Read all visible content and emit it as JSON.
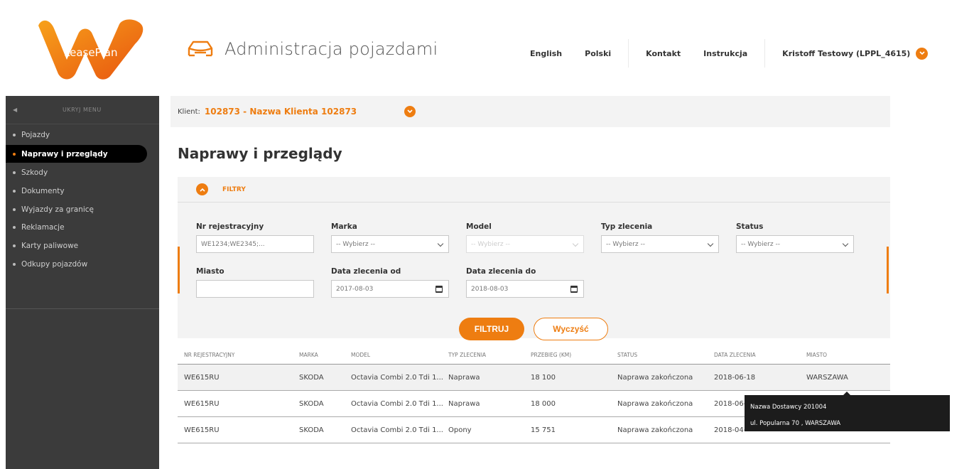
{
  "header": {
    "logo_text": "LeasePlan",
    "app_title": "Administracja pojazdami",
    "nav": [
      "English",
      "Polski",
      "Kontakt",
      "Instrukcja"
    ],
    "user": "Kristoff Testowy  (LPPL_4615)"
  },
  "sidebar": {
    "hide_label": "UKRYJ MENU",
    "items": [
      {
        "label": "Pojazdy",
        "active": false
      },
      {
        "label": "Naprawy i przeglądy",
        "active": true
      },
      {
        "label": "Szkody",
        "active": false
      },
      {
        "label": "Dokumenty",
        "active": false
      },
      {
        "label": "Wyjazdy za granicę",
        "active": false
      },
      {
        "label": "Reklamacje",
        "active": false
      },
      {
        "label": "Karty paliwowe",
        "active": false
      },
      {
        "label": "Odkupy pojazdów",
        "active": false
      }
    ]
  },
  "client": {
    "label": "Klient:",
    "value": "102873 - Nazwa Klienta 102873"
  },
  "page_title": "Naprawy i przeglądy",
  "filters": {
    "toggle_label": "FILTRY",
    "fields": {
      "reg": {
        "label": "Nr rejestracyjny",
        "placeholder": "WE1234;WE2345;..."
      },
      "brand": {
        "label": "Marka",
        "value": "-- Wybierz --"
      },
      "model": {
        "label": "Model",
        "value": "-- Wybierz --"
      },
      "order_type": {
        "label": "Typ zlecenia",
        "value": "-- Wybierz --"
      },
      "status": {
        "label": "Status",
        "value": "-- Wybierz --"
      },
      "city": {
        "label": "Miasto",
        "value": ""
      },
      "date_from": {
        "label": "Data zlecenia od",
        "value": "2017-08-03"
      },
      "date_to": {
        "label": "Data zlecenia do",
        "value": "2018-08-03"
      }
    },
    "filter_button": "FILTRUJ",
    "clear_button": "Wyczyść"
  },
  "table": {
    "columns": [
      "NR REJESTRACYJNY",
      "MARKA",
      "MODEL",
      "TYP ZLECENIA",
      "PRZEBIEG (KM)",
      "STATUS",
      "DATA ZLECENIA",
      "MIASTO"
    ],
    "rows": [
      [
        "WE615RU",
        "SKODA",
        "Octavia Combi 2.0 Tdi 1...",
        "Naprawa",
        "18 100",
        "Naprawa zakończona",
        "2018-06-18",
        "WARSZAWA"
      ],
      [
        "WE615RU",
        "SKODA",
        "Octavia Combi 2.0 Tdi 1...",
        "Naprawa",
        "18 000",
        "Naprawa zakończona",
        "2018-06-",
        ""
      ],
      [
        "WE615RU",
        "SKODA",
        "Octavia Combi 2.0 Tdi 1...",
        "Opony",
        "15 751",
        "Naprawa zakończona",
        "2018-04-",
        ""
      ]
    ]
  },
  "tooltip": {
    "line1": "Nazwa Dostawcy 201004",
    "line2": "ul. Popularna 70 , WARSZAWA"
  },
  "colors": {
    "accent": "#ee7d11",
    "sidebar": "#3b3b3b"
  }
}
